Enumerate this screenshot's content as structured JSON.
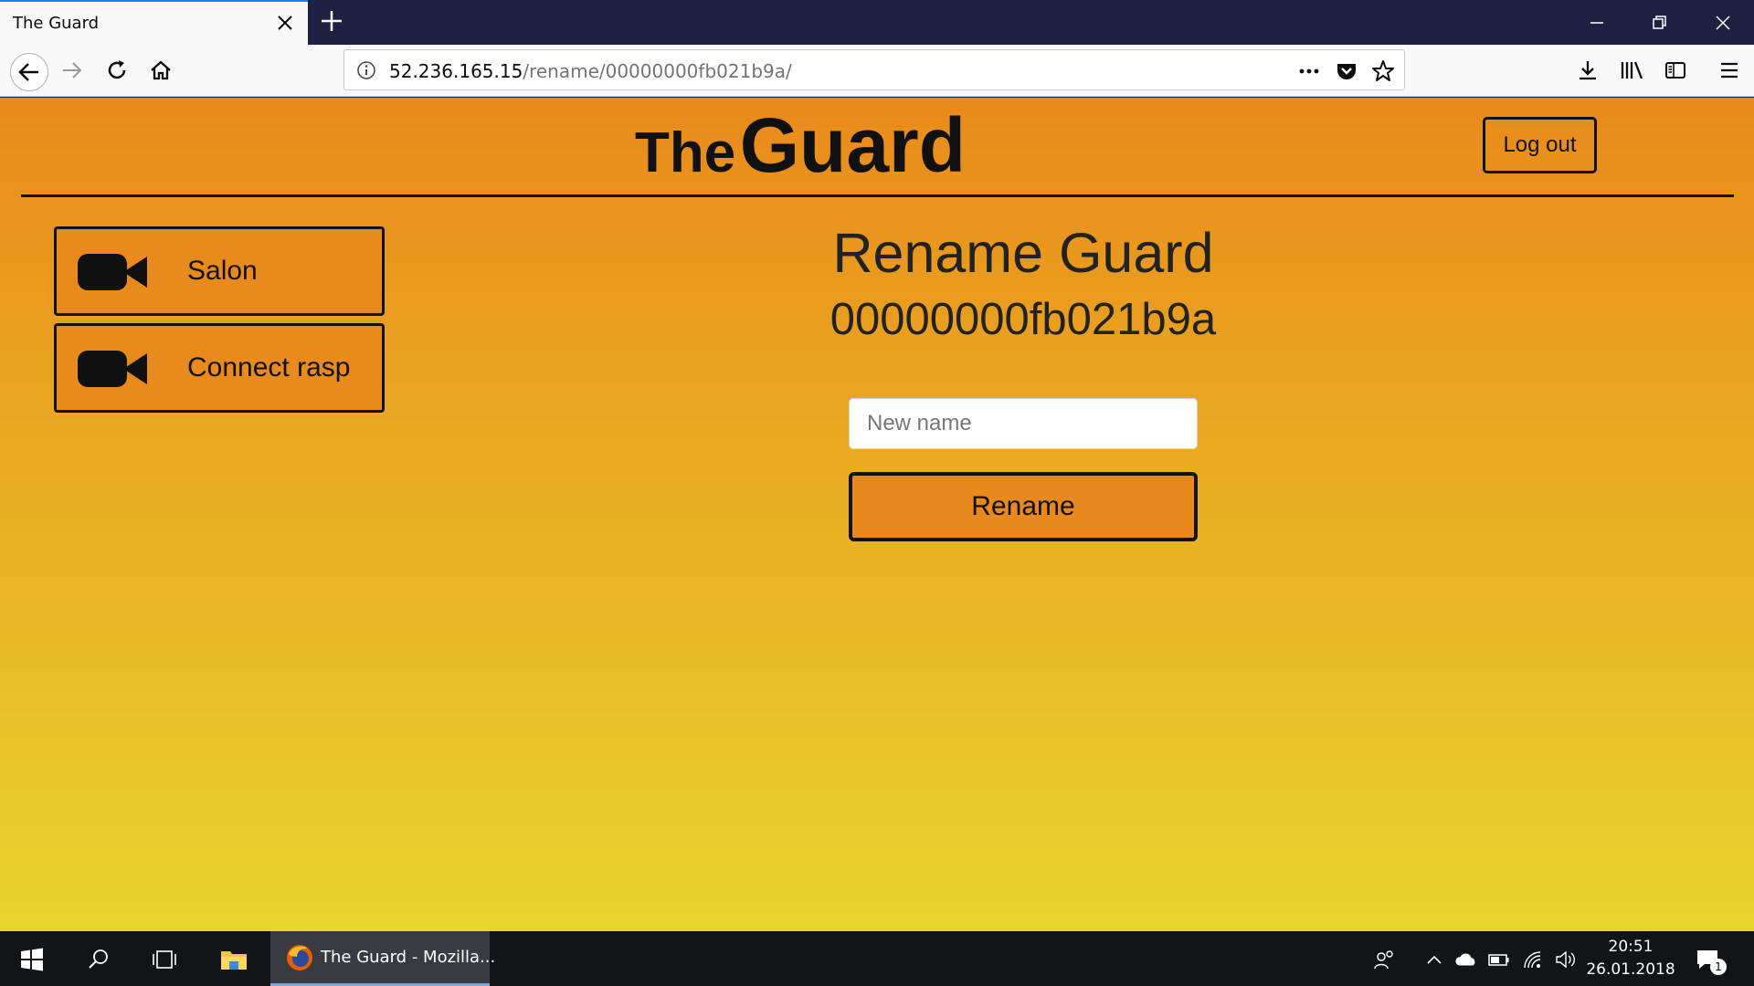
{
  "browser": {
    "tab_title": "The Guard",
    "url_host": "52.236.165.15",
    "url_path": "/rename/00000000fb021b9a/"
  },
  "site": {
    "logo_small": "The",
    "logo_big": "Guard",
    "logout_label": "Log out"
  },
  "sidebar": {
    "items": [
      {
        "label": "Salon",
        "icon": "video-camera-icon"
      },
      {
        "label": "Connect rasp",
        "icon": "video-camera-icon"
      }
    ]
  },
  "main": {
    "title": "Rename Guard",
    "guard_id": "00000000fb021b9a",
    "input_placeholder": "New name",
    "input_value": "",
    "rename_label": "Rename"
  },
  "taskbar": {
    "app_label": "The Guard - Mozilla...",
    "time": "20:51",
    "date": "26.01.2018",
    "notification_count": "1"
  },
  "colors": {
    "gradient_top": "#e98a1b",
    "gradient_bottom": "#e9d42c",
    "button_fill": "#e98a1c",
    "ink": "#111111"
  }
}
